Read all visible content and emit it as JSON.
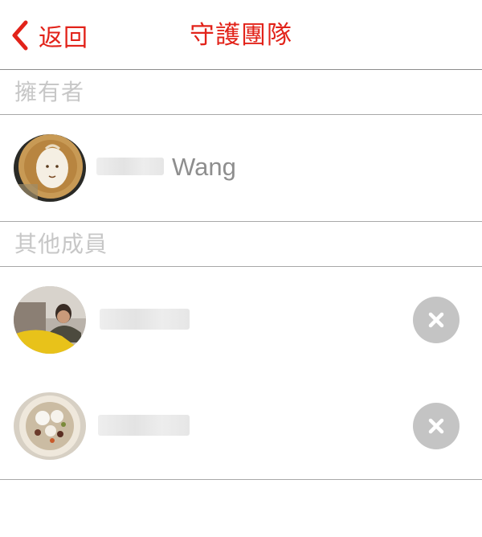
{
  "navbar": {
    "back_label": "返回",
    "title": "守護團隊",
    "accent_color": "#e2231a"
  },
  "sections": {
    "owner_header": "擁有者",
    "members_header": "其他成員"
  },
  "owner": {
    "name_visible": "Wang",
    "avatar_icon": "latte-art-face-avatar"
  },
  "members": [
    {
      "avatar_icon": "person-on-couch-avatar",
      "remove_icon": "close-icon"
    },
    {
      "avatar_icon": "food-bowl-avatar",
      "remove_icon": "close-icon"
    }
  ]
}
